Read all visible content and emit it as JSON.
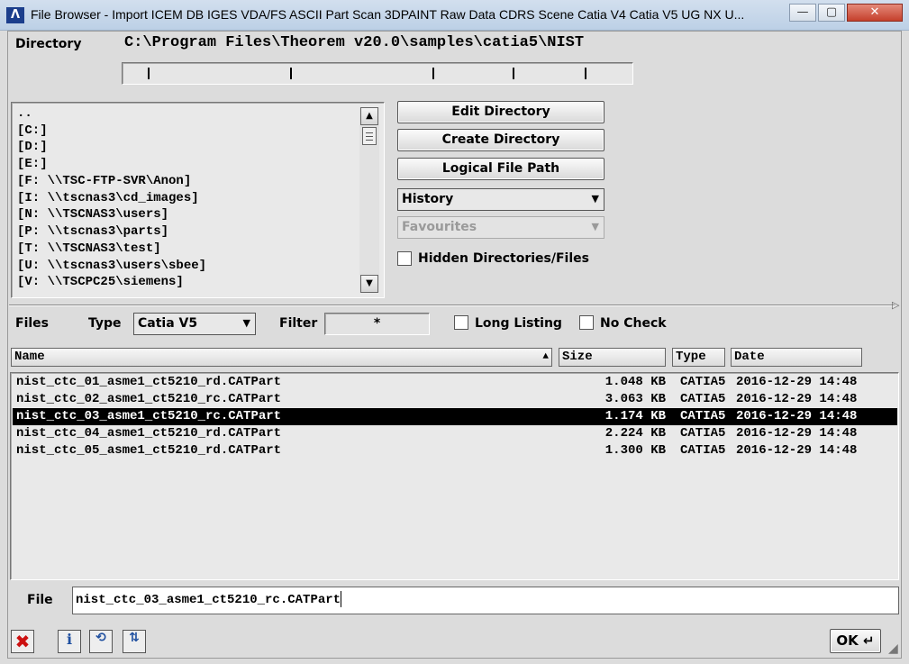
{
  "window": {
    "title": "File Browser - Import  ICEM DB  IGES  VDA/FS  ASCII Part  Scan  3DPAINT  Raw Data  CDRS Scene  Catia V4  Catia V5  UG NX  U...",
    "app_icon": "theorem-logo-icon",
    "min": "—",
    "max": "▢",
    "close": "✕"
  },
  "directory": {
    "label": "Directory",
    "path": "C:\\Program Files\\Theorem v20.0\\samples\\catia5\\NIST",
    "entries": [
      "..",
      "[C:]",
      "[D:]",
      "[E:]",
      "[F: \\\\TSC-FTP-SVR\\Anon]",
      "[I: \\\\tscnas3\\cd_images]",
      "[N: \\\\TSCNAS3\\users]",
      "[P: \\\\tscnas3\\parts]",
      "[T: \\\\TSCNAS3\\test]",
      "[U: \\\\tscnas3\\users\\sbee]",
      "[V: \\\\TSCPC25\\siemens]"
    ]
  },
  "actions": {
    "edit_directory": "Edit Directory",
    "create_directory": "Create Directory",
    "logical_file_path": "Logical File Path",
    "history": "History",
    "favourites": "Favourites",
    "hidden_label": "Hidden Directories/Files"
  },
  "files_bar": {
    "files_label": "Files",
    "type_label": "Type",
    "type_value": "Catia V5",
    "filter_label": "Filter",
    "filter_value": "*",
    "long_listing": "Long Listing",
    "no_check": "No Check"
  },
  "columns": {
    "name": "Name",
    "size": "Size",
    "type": "Type",
    "date": "Date"
  },
  "files": [
    {
      "name": "nist_ctc_01_asme1_ct5210_rd.CATPart",
      "size": "1.048 KB",
      "type": "CATIA5",
      "date": "2016-12-29 14:48"
    },
    {
      "name": "nist_ctc_02_asme1_ct5210_rc.CATPart",
      "size": "3.063 KB",
      "type": "CATIA5",
      "date": "2016-12-29 14:48"
    },
    {
      "name": "nist_ctc_03_asme1_ct5210_rc.CATPart",
      "size": "1.174 KB",
      "type": "CATIA5",
      "date": "2016-12-29 14:48",
      "selected": true
    },
    {
      "name": "nist_ctc_04_asme1_ct5210_rd.CATPart",
      "size": "2.224 KB",
      "type": "CATIA5",
      "date": "2016-12-29 14:48"
    },
    {
      "name": "nist_ctc_05_asme1_ct5210_rd.CATPart",
      "size": "1.300 KB",
      "type": "CATIA5",
      "date": "2016-12-29 14:48"
    }
  ],
  "file_field": {
    "label": "File",
    "value": "nist_ctc_03_asme1_ct5210_rc.CATPart"
  },
  "bottom": {
    "ok_label": "OK ↵"
  },
  "colors": {
    "selection": "#000000",
    "close_red": "#c5402c",
    "cancel_red": "#cc1111",
    "info_blue": "#2050a0"
  }
}
